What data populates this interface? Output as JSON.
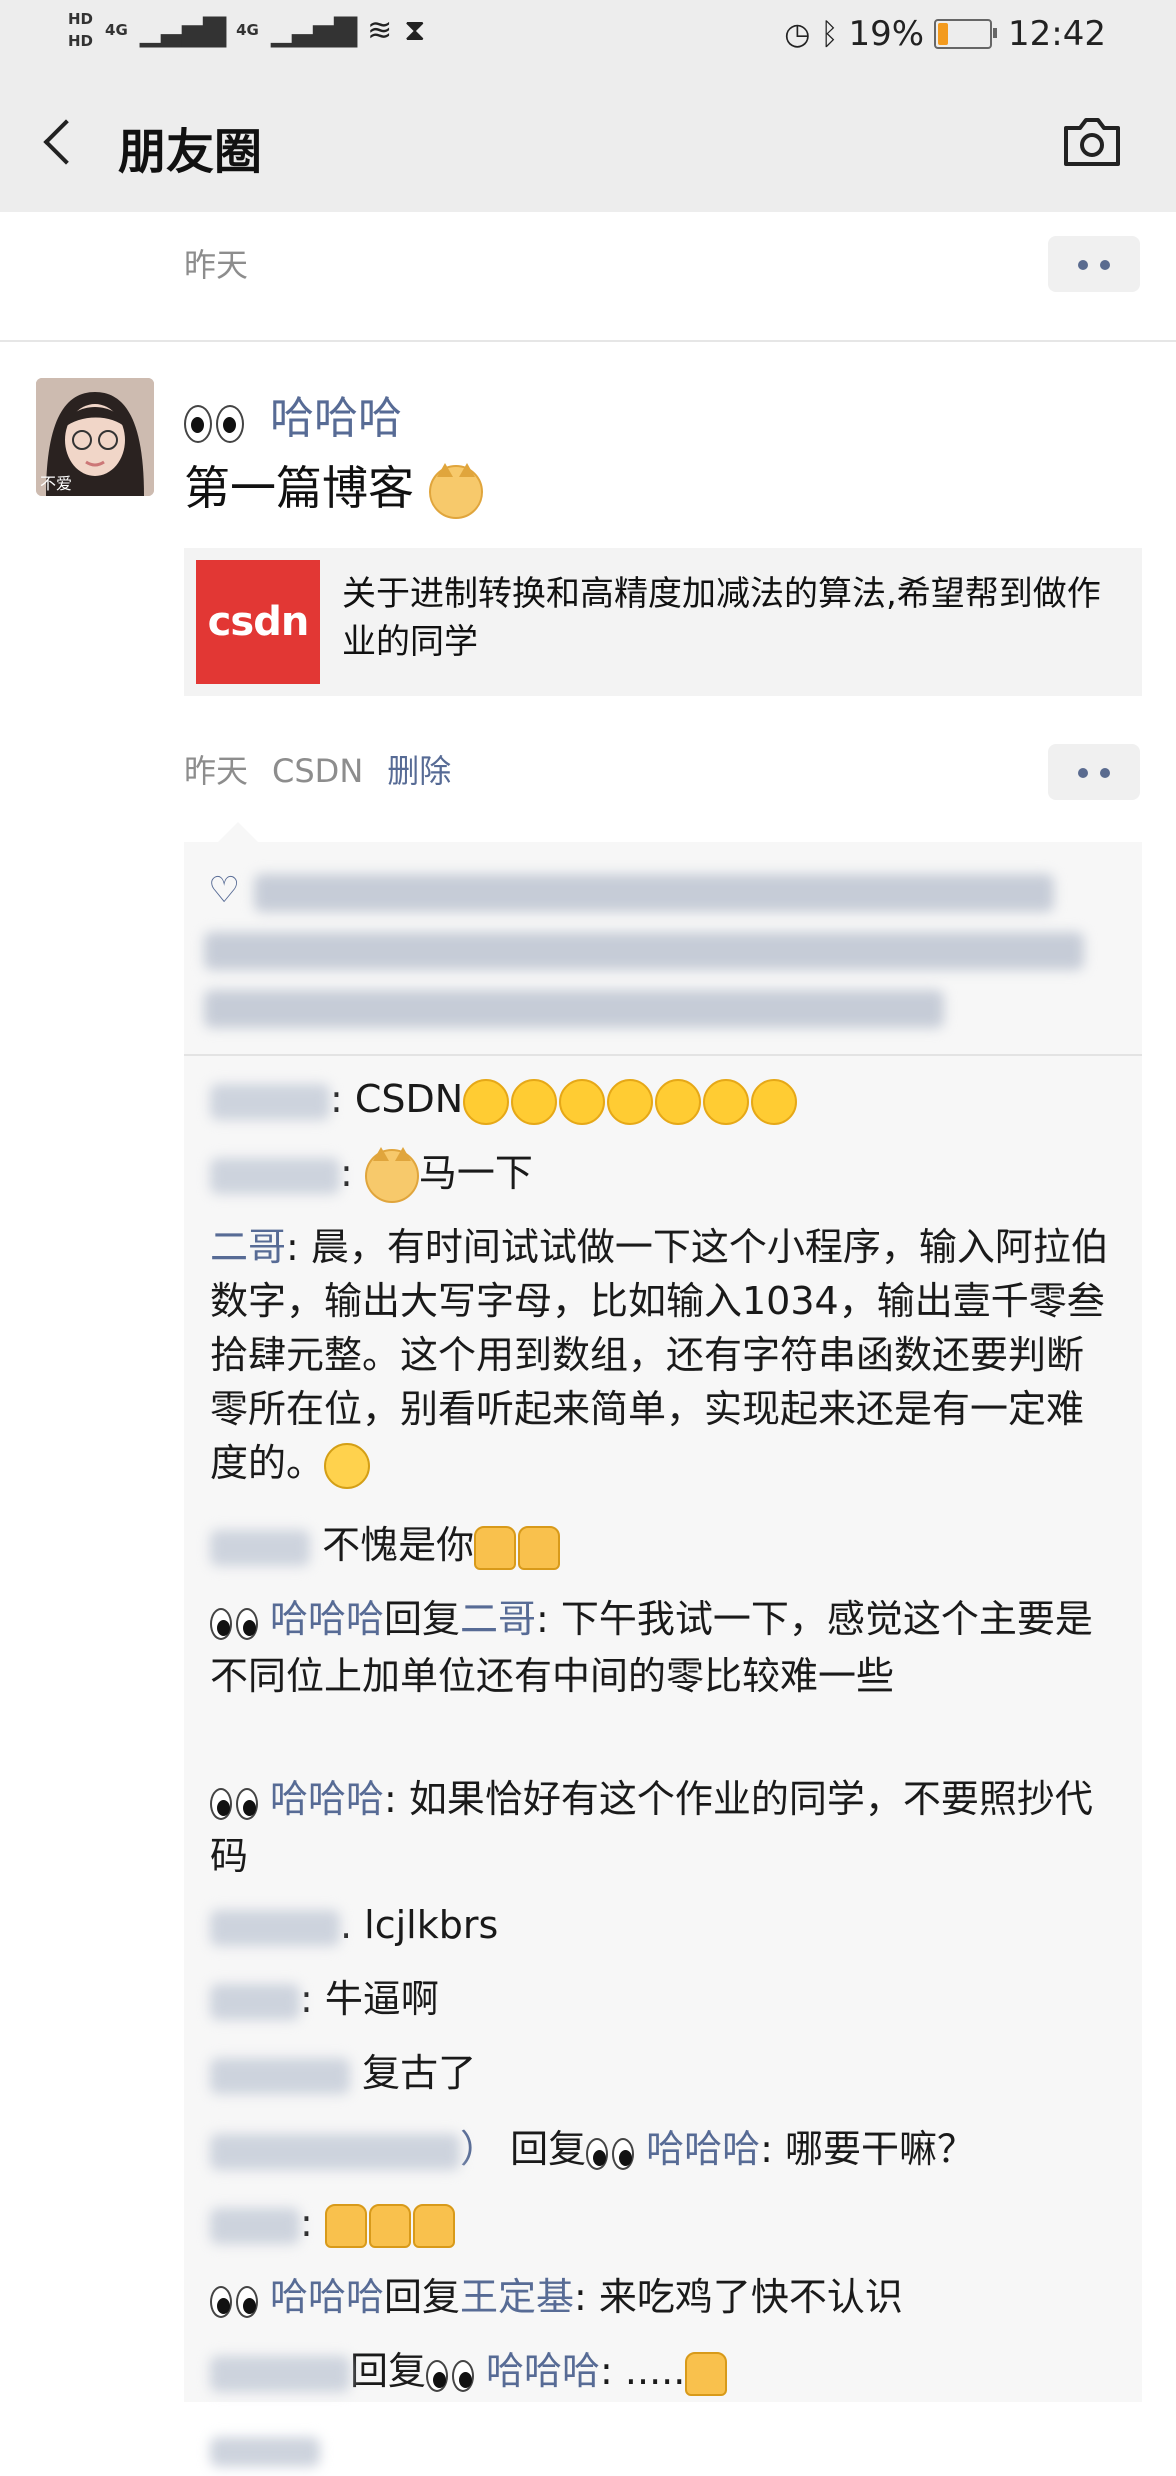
{
  "status": {
    "hd1": "HD",
    "hd2": "HD",
    "net1": "4G",
    "net2": "4G",
    "battery_pct": "19%",
    "time": "12:42"
  },
  "nav": {
    "title": "朋友圈"
  },
  "prev_post": {
    "time": "昨天"
  },
  "post": {
    "avatar_label": "不爱",
    "author": "哈哈哈",
    "text": "第一篇博客",
    "link": {
      "logo": "csdn",
      "title": "关于进制转换和高精度加减法的算法,希望帮到做作业的同学"
    },
    "time": "昨天",
    "source": "CSDN",
    "delete": "删除"
  },
  "comments": [
    {
      "name": "",
      "text": ": CSDN"
    },
    {
      "name": "",
      "text": "马一下"
    },
    {
      "name": "二哥",
      "text": ": 晨，有时间试试做一下这个小程序，输入阿拉伯数字，输出大写字母，比如输入1034，输出壹千零叁拾肆元整。这个用到数组，还有字符串函数还要判断零所在位，别看听起来简单，实现起来还是有一定难度的。"
    },
    {
      "name": "",
      "text": "不愧是你"
    },
    {
      "name": "哈哈哈",
      "reply": "回复",
      "reply_to": "二哥",
      "text": ": 下午我试一下，感觉这个主要是不同位上加单位还有中间的零比较难一些"
    },
    {
      "name": "哈哈哈",
      "text": ": 如果恰好有这个作业的同学，不要照抄代码"
    },
    {
      "name": "",
      "text": ". lcjlkbrs"
    },
    {
      "name": "",
      "text": ": 牛逼啊"
    },
    {
      "name": "",
      "text": "复古了"
    },
    {
      "name": "）",
      "reply": "回复",
      "reply_to": "哈哈哈",
      "text": ": 哪要干嘛？"
    },
    {
      "name": "",
      "text": ":"
    },
    {
      "name": "哈哈哈",
      "reply": "回复",
      "reply_to": "王定基",
      "text": ": 来吃鸡了快不认识"
    },
    {
      "name": "",
      "reply": "回复",
      "reply_to": "哈哈哈",
      "text": ": ....."
    }
  ]
}
